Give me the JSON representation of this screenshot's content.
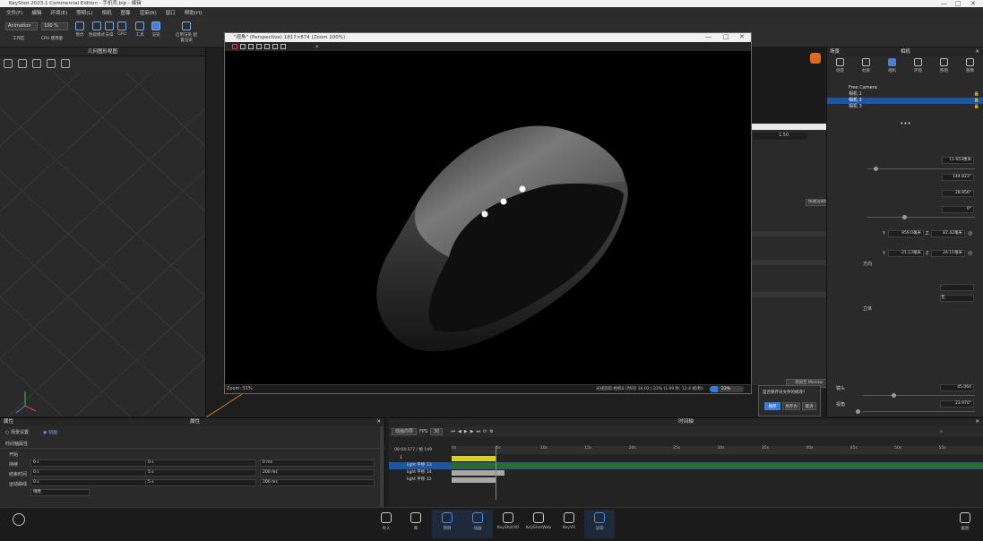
{
  "window": {
    "title": "KeyShot 2023.1 Commercial Edition - 手机壳.bip - 编辑",
    "controls": [
      "—",
      "□",
      "✕"
    ]
  },
  "menu": [
    "文件(F)",
    "编辑",
    "环境(E)",
    "照明(L)",
    "相机",
    "图像",
    "渲染(R)",
    "窗口",
    "帮助(H)"
  ],
  "toolbar": {
    "mode_select": "Animation",
    "zoom_select": "100 %",
    "workspace_label": "工作区",
    "cpu_label": "CPU 使用量",
    "pause_label": "暂停",
    "perf_label": "性能模式",
    "denoise_label": "去噪",
    "gpu_label": "GPU",
    "tool_label": "工具",
    "render_label": "渲染",
    "tool2_label": "工具",
    "nurbs_label": "启用渲染\n配置渲染",
    "extra_label": "快速截图"
  },
  "left_view": {
    "header": "几何图形视图",
    "tools": [
      "gear-icon",
      "box-icon",
      "camera-icon",
      "layers-icon",
      "network-icon"
    ]
  },
  "render_window": {
    "title": "\"视角\" (Perspective) 1817×874 (Zoom 100%)",
    "zoom_status": "Zoom: 51%",
    "right_status": "光线追踪:相机0 [时间] 34.02 | 23% (1.99 秒, 12.4 帧/秒)",
    "progress_percent": 23,
    "progress_label": "23%"
  },
  "dialog": {
    "top_value": "1.50",
    "select_label": "快速渲染提示",
    "monitor_button": "添加至 Monitor",
    "cancel_button": "取消",
    "dropdown_value": "无"
  },
  "right_panel": {
    "title": "相机",
    "side_label": "场景",
    "tabs": [
      {
        "label": "场景",
        "icon": "tree-icon",
        "selected": false
      },
      {
        "label": "材质",
        "icon": "sphere-icon",
        "selected": false
      },
      {
        "label": "相机",
        "icon": "camera-icon",
        "selected": true
      },
      {
        "label": "环境",
        "icon": "sun-icon",
        "selected": false
      },
      {
        "label": "照明",
        "icon": "bulb-icon",
        "selected": false
      },
      {
        "label": "图像",
        "icon": "image-icon",
        "selected": false
      }
    ],
    "cameras": [
      {
        "name": "Free Camera",
        "selected": false
      },
      {
        "name": "相机 1",
        "selected": false
      },
      {
        "name": "相机 2",
        "selected": true
      },
      {
        "name": "相机 3",
        "selected": false
      }
    ],
    "fields": {
      "distance": "11.653厘米",
      "azimuth": "144.823°",
      "inclination": "28.956°",
      "twist": "0°",
      "pos_y": "959.0毫米",
      "pos_z": "87.42毫米",
      "pos_y2": "-21.13毫米",
      "pos_z2": "24.11毫米",
      "lens": "45.064",
      "fov": "23.970°"
    },
    "labels": {
      "y": "Y",
      "z": "Z",
      "mode": "镜头",
      "angle": "视角",
      "dir_label": "方向",
      "stereo": "立体"
    },
    "select_1": "-",
    "select_2": "无"
  },
  "save_popup": {
    "message": "是否保存对文件的修改?",
    "save": "保存",
    "save_as": "另存为",
    "cancel": "取消"
  },
  "bottom_left": {
    "title": "属性",
    "head_right": "属性",
    "toggle_a": "场景设置",
    "toggle_b": "动画",
    "section": "时间轴属性",
    "rows": [
      {
        "label": "开始",
        "v1": "0 s",
        "v2": "0 s",
        "v3": "0 ms"
      },
      {
        "label": "持续",
        "v1": "0 s",
        "v2": "5 s",
        "v3": "200 ms"
      },
      {
        "label": "结束时间",
        "v1": "0 s",
        "v2": "5 s",
        "v3": "200 ms"
      }
    ],
    "motion_label": "运动曲线",
    "motion_value": "线性"
  },
  "timeline": {
    "title": "时间轴",
    "anim_button": "动画向导",
    "fps_label": "FPS",
    "fps_value": "30",
    "time_readout": "00:04:577 / 帧 149",
    "ticks": [
      "0s",
      "5s",
      "10s",
      "15s",
      "20s",
      "25s",
      "30s",
      "35s",
      "40s",
      "45s",
      "50s",
      "55s",
      "60s"
    ],
    "tracks": [
      {
        "name": "1",
        "bar_color": "#d8d02a",
        "start": 0,
        "end": 5
      },
      {
        "name": "light 平移 13",
        "bar_color": "#2d6b2d",
        "start": 0,
        "end": 60,
        "selected": true
      },
      {
        "name": "light 平移 14",
        "bar_color": "#a8a8a8",
        "start": 0,
        "end": 6
      },
      {
        "name": "light 平移 12",
        "bar_color": "#a8a8a8",
        "start": 0,
        "end": 5
      }
    ],
    "playhead_seconds": 5
  },
  "dock": [
    {
      "label": "导入",
      "icon": "import-icon",
      "active": false
    },
    {
      "label": "库",
      "icon": "book-icon",
      "active": false
    },
    {
      "label": "项目",
      "icon": "project-icon",
      "active": true
    },
    {
      "label": "动画",
      "icon": "animation-icon",
      "active": true
    },
    {
      "label": "KeyShotXR",
      "icon": "xr-icon",
      "active": false
    },
    {
      "label": "KeyShotWeb",
      "icon": "web-icon",
      "active": false
    },
    {
      "label": "KeyVR",
      "icon": "vr-icon",
      "active": false
    },
    {
      "label": "渲染",
      "icon": "render-icon",
      "active": true
    },
    {
      "label": "截图",
      "icon": "screenshot-icon",
      "active": false
    }
  ],
  "colors": {
    "accent": "#3a7bd5",
    "selection": "#1e56a6",
    "track_yellow": "#d8d02a",
    "track_green": "#2d6b2d"
  }
}
